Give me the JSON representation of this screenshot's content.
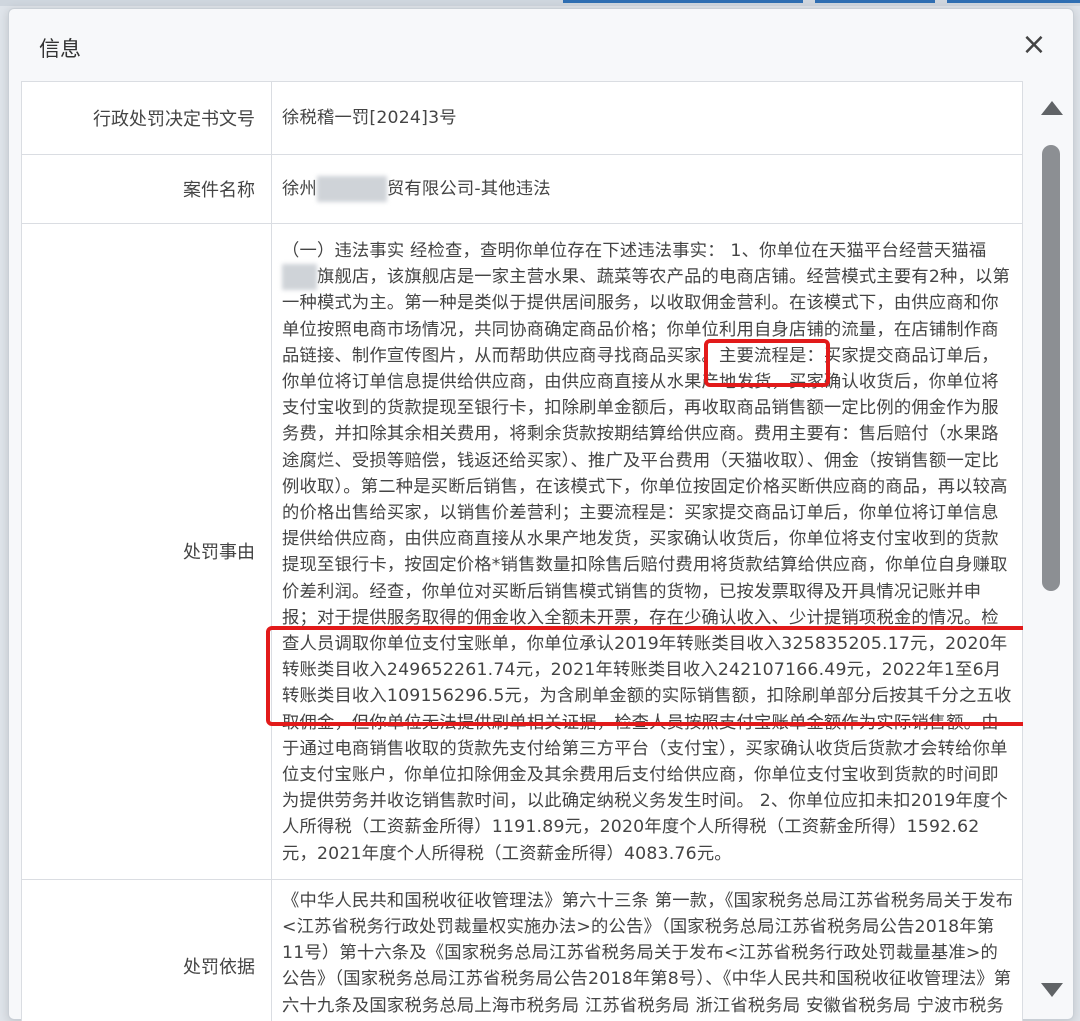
{
  "dialog": {
    "title": "信息",
    "close_label": "×"
  },
  "rows": {
    "doc_no": {
      "label": "行政处罚决定书文号",
      "value": "徐税稽一罚[2024]3号"
    },
    "case_name": {
      "label": "案件名称",
      "value_prefix": "徐州",
      "value_suffix": "贸有限公司-其他违法"
    },
    "reason": {
      "label": "处罚事由",
      "text_part1": "（一）违法事实 经检查，查明你单位存在下述违法事实： 1、你单位在天猫平台经营天猫福",
      "text_part2": "旗舰店，该旗舰店是一家主营水果、蔬菜等农产品的电商店铺。经营模式主要有2种，以第一种模式为主。第一种是类似于提供居间服务，以收取佣金营利。在该模式下，由供应商和你单位按照电商市场情况，共同协商确定商品价格；你单位利用自身店铺的流量，在店铺制作商品链接、制作宣传图片，从而帮助供应商寻找商品买家。主要流程是：买家提交商品订单后，你单位将订单信息提供给供应商，由供应商直接从水果产地发货，买家确认收货后，你单位将支付宝收到的货款提现至银行卡，扣除刷单金额后，再收取商品销售额一定比例的佣金作为服务费，并扣除其余相关费用，将剩余货款按期结算给供应商。费用主要有：售后赔付（水果路途腐烂、受损等赔偿，钱返还给买家）、推广及平台费用（天猫收取）、佣金（按销售额一定比例收取）。第二种是买断后销售，在该模式下，你单位按固定价格买断供应商的商品，再以较高的价格出售给买家，以销售价差营利；主要流程是：买家提交商品订单后，你单位将订单信息提供给供应商，由供应商直接从水果产地发货，买家确认收货后，你单位将支付宝收到的货款提现至银行卡，按固定价格*销售数量扣除售后赔付费用将货款结算给供应商，你单位自身赚取价差利润。经查，你单位对买断后销售模式销售的货物，已按发票取得及开具情况记账并申报；对于提供服务取得的佣金收入全额未开票，存在少确认收入、少计提销项税金的情况。检查人员调取你单位支付宝账单，你单位承认2019年转账类目收入325835205.17元，2020年转账类目收入249652261.74元，2021年转账类目收入242107166.49元，2022年1至6月转账类目收入109156296.5元，为含刷单金额的实际销售额，扣除刷单部分后按其千分之五收取佣金，但你单位无法提供刷单相关证据，检查人员按照支付宝账单金额作为实际销售额。由于通过电商销售收取的货款先支付给第三方平台（支付宝），买家确认收货后货款才会转给你单位支付宝账户，你单位扣除佣金及其余费用后支付给供应商，你单位支付宝收到货款的时间即为提供劳务并收讫销售款时间，以此确定纳税义务发生时间。 2、你单位应扣未扣2019年度个人所得税（工资薪金所得）1191.89元，2020年度个人所得税（工资薪金所得）1592.62元，2021年度个人所得税（工资薪金所得）4083.76元。"
    },
    "basis": {
      "label": "处罚依据",
      "text": "《中华人民共和国税收征收管理法》第六十三条 第一款，《国家税务总局江苏省税务局关于发布<江苏省税务行政处罚裁量权实施办法>的公告》（国家税务总局江苏省税务局公告2018年第11号）第十六条及《国家税务总局江苏省税务局关于发布<江苏省税务行政处罚裁量基准>的公告》（国家税务总局江苏省税务局公告2018年第8号）、《中华人民共和国税收征收管理法》第六十九条及国家税务总局上海市税务局 江苏省税务局 浙江省税务局 安徽省税务局 宁波市税务局关于发布《长江三角洲区域登记 账证 征收 检查类税务违法行为行政处罚裁量基准》的公告"
    }
  },
  "colors": {
    "highlight": "#e21a1a",
    "scroll_thumb": "#8c8f93",
    "top_accent": "#2f6fb3"
  },
  "icons": [
    "close-icon",
    "scroll-up-arrow-icon",
    "scroll-down-arrow-icon"
  ]
}
